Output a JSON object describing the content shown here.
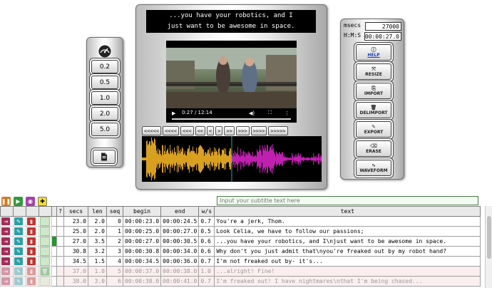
{
  "speed_panel": {
    "gauge_icon": "speedometer-icon",
    "speeds": [
      "0.2",
      "0.5",
      "1.0",
      "2.0",
      "5.0"
    ],
    "doc_icon": "document-icon"
  },
  "player": {
    "subtitle_lines": [
      "...you have your robotics, and I",
      "just want to be awesome in space."
    ],
    "video_time": "0:27 / 12:14",
    "nav_buttons": [
      "<<<<<",
      "<<<<",
      "<<<",
      "<<",
      "<",
      ">",
      ">>",
      ">>>",
      ">>>>",
      ">>>>>"
    ],
    "waveform_colors": {
      "played": "#d9a020",
      "unplayed": "#c020b0",
      "cursor": "#2aa6a6"
    }
  },
  "tool_panel": {
    "msecs_label": "msecs",
    "msecs_value": "27000",
    "hms_label": "H:M:S",
    "hms_value": "00:00:27.0",
    "buttons": [
      {
        "label": "HELP",
        "icon": "info-icon"
      },
      {
        "label": "RESIZE",
        "icon": "resize-icon"
      },
      {
        "label": "IMPORT",
        "icon": "import-icon"
      },
      {
        "label": "DELIMPORT",
        "icon": "trash-icon"
      },
      {
        "label": "EXPORT",
        "icon": "export-icon"
      },
      {
        "label": "ERASE",
        "icon": "eraser-icon"
      },
      {
        "label": "WAVEFORM",
        "icon": "waveform-icon"
      }
    ]
  },
  "subtitle_input": {
    "placeholder": "Input your subtitle text here"
  },
  "table": {
    "headers": [
      "?",
      "secs",
      "len",
      "seq",
      "begin",
      "end",
      "w/s",
      "text"
    ],
    "rows": [
      {
        "secs": "23.0",
        "len": "2.0",
        "seq": "0",
        "begin": "00:00:23.0",
        "end": "00:00:24.5",
        "ws": "0.7",
        "text": "You're a jerk, Thom.",
        "current": false,
        "faded": false
      },
      {
        "secs": "25.0",
        "len": "2.0",
        "seq": "1",
        "begin": "00:00:25.0",
        "end": "00:00:27.0",
        "ws": "0.5",
        "text": "Look Celia, we have to follow our passions;",
        "current": false,
        "faded": false
      },
      {
        "secs": "27.0",
        "len": "3.5",
        "seq": "2",
        "begin": "00:00:27.0",
        "end": "00:00:30.5",
        "ws": "0.6",
        "text": "...you have your robotics, and I\\njust want to be awesome in space.",
        "current": true,
        "faded": false
      },
      {
        "secs": "30.8",
        "len": "3.2",
        "seq": "3",
        "begin": "00:00:30.8",
        "end": "00:00:34.0",
        "ws": "0.6",
        "text": "Why don't you just admit that\\nyou're freaked out by my robot hand?",
        "current": false,
        "faded": false
      },
      {
        "secs": "34.5",
        "len": "1.5",
        "seq": "4",
        "begin": "00:00:34.5",
        "end": "00:00:36.0",
        "ws": "0.7",
        "text": "I'm not freaked out by- it's...",
        "current": false,
        "faded": false
      },
      {
        "secs": "37.0",
        "len": "1.0",
        "seq": "5",
        "begin": "00:00:37.0",
        "end": "00:00:38.0",
        "ws": "1.0",
        "text": "...alright! Fine!",
        "current": false,
        "faded": true
      },
      {
        "secs": "38.0",
        "len": "3.0",
        "seq": "6",
        "begin": "00:00:38.0",
        "end": "00:00:41.0",
        "ws": "0.7",
        "text": "I'm freaked out! I have nightmares\\nthat I'm being chased...",
        "current": false,
        "faded": true
      }
    ]
  }
}
